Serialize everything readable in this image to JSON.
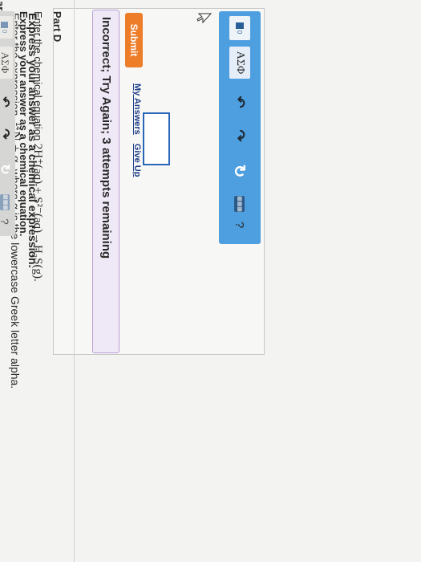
{
  "header": {
    "fragment": "ar"
  },
  "question": {
    "instruction_prefix": "Enter the expression",
    "isotope_mass": "14",
    "isotope_atomic": "7",
    "expression": "N + α,",
    "instruction_suffix": "where α is the lowercase Greek letter alpha.",
    "express_label": "Express your answer as a chemical expression."
  },
  "toolbar": {
    "template_icon": "template-icon",
    "template_small": "0",
    "greek_label": "ΑΣΦ",
    "undo_icon": "undo-icon",
    "redo_icon": "redo-icon",
    "reset_icon": "reset-icon",
    "keyboard_icon": "keyboard-icon",
    "keyboard_label": "▦▦▦",
    "help_label": "?",
    "toolbar_color": "#4e9fe0"
  },
  "answer": {
    "value": ""
  },
  "actions": {
    "submit_label": "Submit",
    "my_answers_label": "My Answers",
    "give_up_label": "Give Up",
    "submit_color": "#ee7d2a"
  },
  "feedback": {
    "text": "Incorrect; Try Again; 3 attempts remaining",
    "color": "#efe8f6"
  },
  "part_d": {
    "title": "Part D",
    "instruction_prefix": "Enter the chemical equation",
    "equation": "2H⁺(aq) + S²⁻(aq)→H₂S(g).",
    "express_label": "Express your answer as a chemical equation.",
    "toolbar": {
      "template_small": "0",
      "greek_label": "ΑΣΦ",
      "keyboard_label": "▦▦▦",
      "help_label": "?"
    }
  }
}
